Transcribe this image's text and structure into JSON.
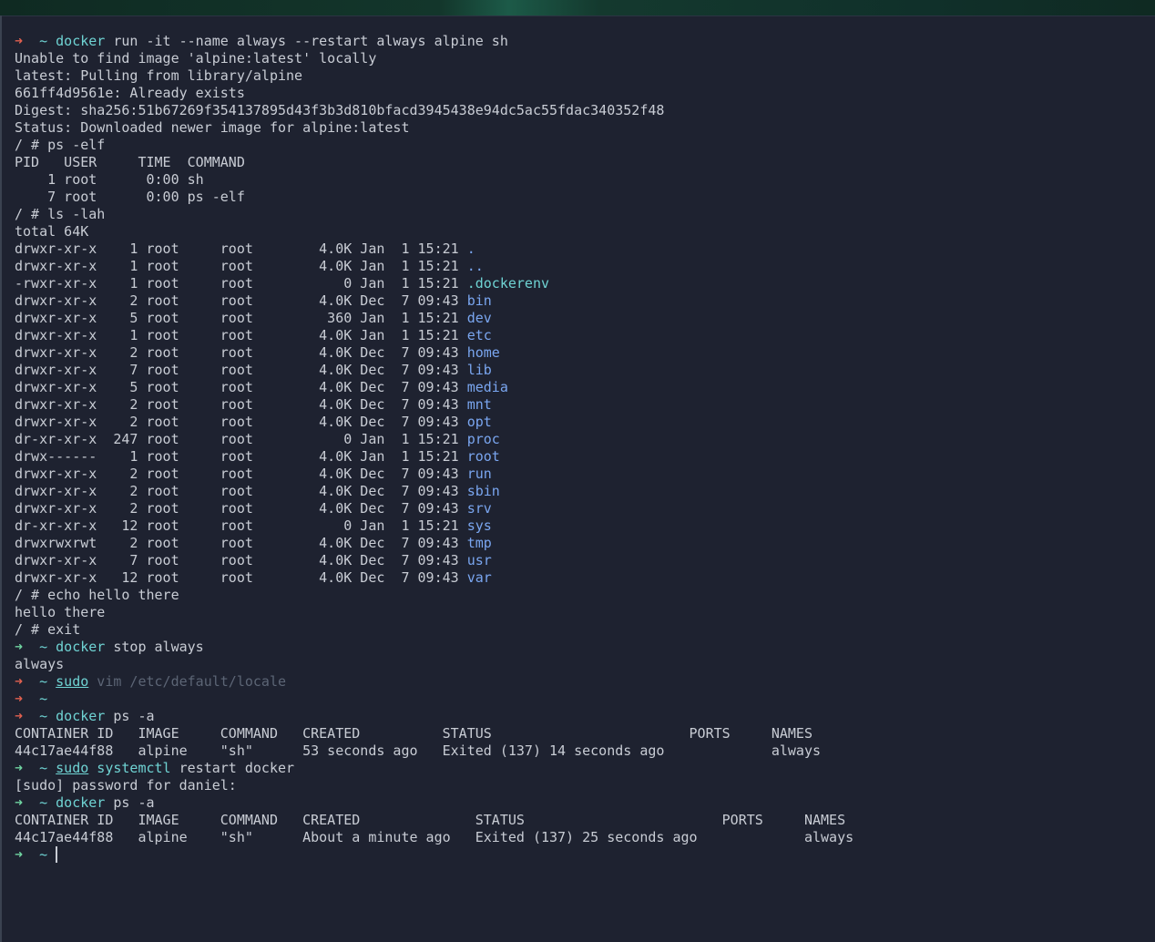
{
  "prompt": {
    "arrow": "➜",
    "tilde": "~"
  },
  "cmd1": {
    "cmd": "docker",
    "args": " run -it --name always --restart always alpine sh"
  },
  "out1": [
    "Unable to find image 'alpine:latest' locally",
    "latest: Pulling from library/alpine",
    "661ff4d9561e: Already exists",
    "Digest: sha256:51b67269f354137895d43f3b3d810bfacd3945438e94dc5ac55fdac340352f48",
    "Status: Downloaded newer image for alpine:latest"
  ],
  "ps_cmd": "/ # ps -elf",
  "ps_header": "PID   USER     TIME  COMMAND",
  "ps_rows": [
    "    1 root      0:00 sh",
    "    7 root      0:00 ps -elf"
  ],
  "ls_cmd": "/ # ls -lah",
  "ls_total": "total 64K",
  "ls_rows": [
    {
      "meta": "drwxr-xr-x    1 root     root        4.0K Jan  1 15:21 ",
      "name": ".",
      "kind": "dir"
    },
    {
      "meta": "drwxr-xr-x    1 root     root        4.0K Jan  1 15:21 ",
      "name": "..",
      "kind": "dir"
    },
    {
      "meta": "-rwxr-xr-x    1 root     root           0 Jan  1 15:21 ",
      "name": ".dockerenv",
      "kind": "file"
    },
    {
      "meta": "drwxr-xr-x    2 root     root        4.0K Dec  7 09:43 ",
      "name": "bin",
      "kind": "dir"
    },
    {
      "meta": "drwxr-xr-x    5 root     root         360 Jan  1 15:21 ",
      "name": "dev",
      "kind": "dir"
    },
    {
      "meta": "drwxr-xr-x    1 root     root        4.0K Jan  1 15:21 ",
      "name": "etc",
      "kind": "dir"
    },
    {
      "meta": "drwxr-xr-x    2 root     root        4.0K Dec  7 09:43 ",
      "name": "home",
      "kind": "dir"
    },
    {
      "meta": "drwxr-xr-x    7 root     root        4.0K Dec  7 09:43 ",
      "name": "lib",
      "kind": "dir"
    },
    {
      "meta": "drwxr-xr-x    5 root     root        4.0K Dec  7 09:43 ",
      "name": "media",
      "kind": "dir"
    },
    {
      "meta": "drwxr-xr-x    2 root     root        4.0K Dec  7 09:43 ",
      "name": "mnt",
      "kind": "dir"
    },
    {
      "meta": "drwxr-xr-x    2 root     root        4.0K Dec  7 09:43 ",
      "name": "opt",
      "kind": "dir"
    },
    {
      "meta": "dr-xr-xr-x  247 root     root           0 Jan  1 15:21 ",
      "name": "proc",
      "kind": "dir"
    },
    {
      "meta": "drwx------    1 root     root        4.0K Jan  1 15:21 ",
      "name": "root",
      "kind": "dir"
    },
    {
      "meta": "drwxr-xr-x    2 root     root        4.0K Dec  7 09:43 ",
      "name": "run",
      "kind": "dir"
    },
    {
      "meta": "drwxr-xr-x    2 root     root        4.0K Dec  7 09:43 ",
      "name": "sbin",
      "kind": "dir"
    },
    {
      "meta": "drwxr-xr-x    2 root     root        4.0K Dec  7 09:43 ",
      "name": "srv",
      "kind": "dir"
    },
    {
      "meta": "dr-xr-xr-x   12 root     root           0 Jan  1 15:21 ",
      "name": "sys",
      "kind": "dir"
    },
    {
      "meta": "drwxrwxrwt    2 root     root        4.0K Dec  7 09:43 ",
      "name": "tmp",
      "kind": "dir"
    },
    {
      "meta": "drwxr-xr-x    7 root     root        4.0K Dec  7 09:43 ",
      "name": "usr",
      "kind": "dir"
    },
    {
      "meta": "drwxr-xr-x   12 root     root        4.0K Dec  7 09:43 ",
      "name": "var",
      "kind": "dir"
    }
  ],
  "echo_cmd": "/ # echo hello there",
  "echo_out": "hello there",
  "exit_cmd": "/ # exit",
  "cmd2": {
    "cmd": "docker",
    "args": " stop always"
  },
  "out2": "always",
  "cmd3": {
    "sudo": "sudo",
    "rest": " vim /etc/default/locale"
  },
  "cmd4": {
    "cmd": "docker",
    "args": " ps -a"
  },
  "ps1": {
    "header": "CONTAINER ID   IMAGE     COMMAND   CREATED          STATUS                        PORTS     NAMES",
    "row": "44c17ae44f88   alpine    \"sh\"      53 seconds ago   Exited (137) 14 seconds ago             always"
  },
  "cmd5": {
    "sudo": "sudo",
    "cmd": " systemctl",
    "args": " restart docker"
  },
  "sudo_prompt": "[sudo] password for daniel:",
  "cmd6": {
    "cmd": "docker",
    "args": " ps -a"
  },
  "ps2": {
    "header": "CONTAINER ID   IMAGE     COMMAND   CREATED              STATUS                        PORTS     NAMES",
    "row": "44c17ae44f88   alpine    \"sh\"      About a minute ago   Exited (137) 25 seconds ago             always"
  },
  "colors": {
    "background": "#1e2230",
    "text": "#c8ccd4",
    "prompt_error": "#e0604f",
    "prompt_ok": "#6fd3a0",
    "command": "#6fd3d3",
    "directory": "#7aa6f0"
  }
}
